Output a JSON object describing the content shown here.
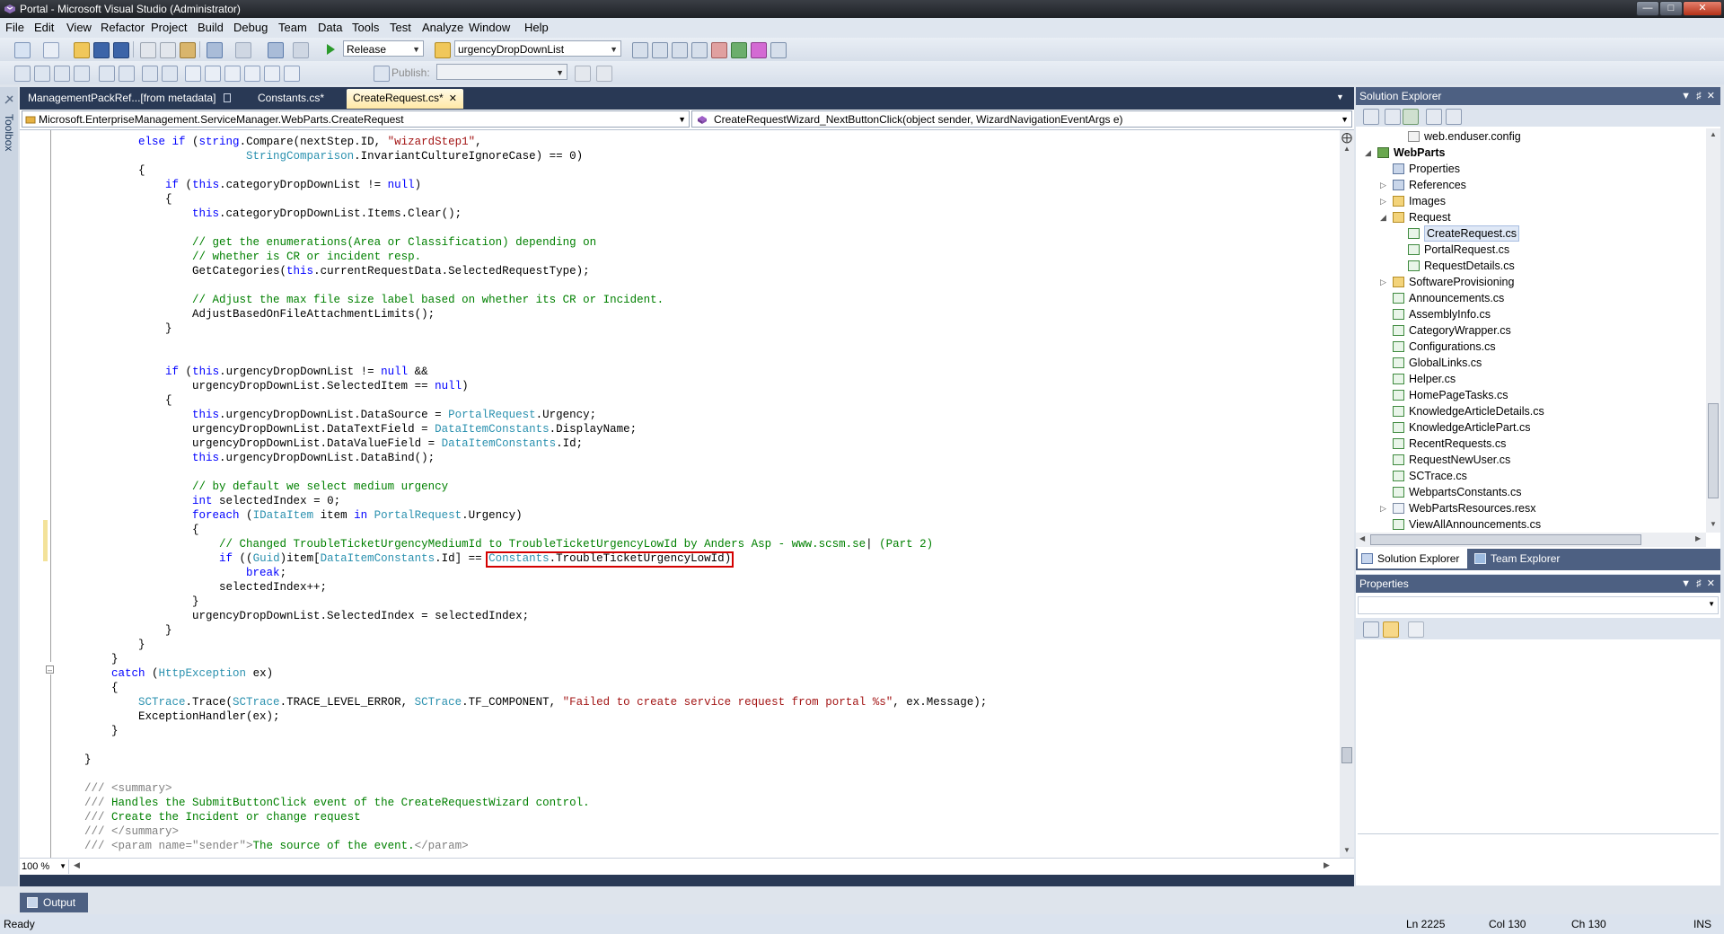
{
  "window": {
    "title": "Portal - Microsoft Visual Studio (Administrator)"
  },
  "menu": [
    "File",
    "Edit",
    "View",
    "Refactor",
    "Project",
    "Build",
    "Debug",
    "Team",
    "Data",
    "Tools",
    "Test",
    "Analyze",
    "Window",
    "Help"
  ],
  "toolbar": {
    "configuration": "Release",
    "find_combo": "urgencyDropDownList",
    "publish_label": "Publish:"
  },
  "toolbox": {
    "label": "Toolbox"
  },
  "editor": {
    "tabs": [
      {
        "label": "ManagementPackRef...[from metadata]"
      },
      {
        "label": "Constants.cs*"
      },
      {
        "label": "CreateRequest.cs*"
      }
    ],
    "type_combo": "Microsoft.EnterpriseManagement.ServiceManager.WebParts.CreateRequest",
    "member_combo": "CreateRequestWizard_NextButtonClick(object sender, WizardNavigationEventArgs e)",
    "zoom": "100 %",
    "code_lines": [
      {
        "t": [
          [
            "",
            "            "
          ],
          [
            "kw",
            "else if"
          ],
          [
            "",
            " ("
          ],
          [
            "kw",
            "string"
          ],
          [
            "",
            ".Compare(nextStep.ID, "
          ],
          [
            "st",
            "\"wizardStep1\""
          ],
          [
            "",
            ","
          ]
        ]
      },
      {
        "t": [
          [
            "",
            "                            "
          ],
          [
            "ty",
            "StringComparison"
          ],
          [
            "",
            ".InvariantCultureIgnoreCase) == 0)"
          ]
        ]
      },
      {
        "t": [
          [
            "",
            "            {"
          ]
        ]
      },
      {
        "t": [
          [
            "",
            "                "
          ],
          [
            "kw",
            "if"
          ],
          [
            "",
            " ("
          ],
          [
            "kw",
            "this"
          ],
          [
            "",
            ".categoryDropDownList != "
          ],
          [
            "kw",
            "null"
          ],
          [
            "",
            ")"
          ]
        ]
      },
      {
        "t": [
          [
            "",
            "                {"
          ]
        ]
      },
      {
        "t": [
          [
            "",
            "                    "
          ],
          [
            "kw",
            "this"
          ],
          [
            "",
            ".categoryDropDownList.Items.Clear();"
          ]
        ]
      },
      {
        "t": [
          [
            "",
            ""
          ]
        ]
      },
      {
        "t": [
          [
            "",
            "                    "
          ],
          [
            "cm",
            "// get the enumerations(Area or Classification) depending on"
          ]
        ]
      },
      {
        "t": [
          [
            "",
            "                    "
          ],
          [
            "cm",
            "// whether is CR or incident resp."
          ]
        ]
      },
      {
        "t": [
          [
            "",
            "                    GetCategories("
          ],
          [
            "kw",
            "this"
          ],
          [
            "",
            ".currentRequestData.SelectedRequestType);"
          ]
        ]
      },
      {
        "t": [
          [
            "",
            ""
          ]
        ]
      },
      {
        "t": [
          [
            "",
            "                    "
          ],
          [
            "cm",
            "// Adjust the max file size label based on whether its CR or Incident."
          ]
        ]
      },
      {
        "t": [
          [
            "",
            "                    AdjustBasedOnFileAttachmentLimits();"
          ]
        ]
      },
      {
        "t": [
          [
            "",
            "                }"
          ]
        ]
      },
      {
        "t": [
          [
            "",
            ""
          ]
        ]
      },
      {
        "t": [
          [
            "",
            ""
          ]
        ]
      },
      {
        "t": [
          [
            "",
            "                "
          ],
          [
            "kw",
            "if"
          ],
          [
            "",
            " ("
          ],
          [
            "kw",
            "this"
          ],
          [
            "",
            ".urgencyDropDownList != "
          ],
          [
            "kw",
            "null"
          ],
          [
            "",
            " &&"
          ]
        ]
      },
      {
        "t": [
          [
            "",
            "                    urgencyDropDownList.SelectedItem == "
          ],
          [
            "kw",
            "null"
          ],
          [
            "",
            ")"
          ]
        ]
      },
      {
        "t": [
          [
            "",
            "                {"
          ]
        ]
      },
      {
        "t": [
          [
            "",
            "                    "
          ],
          [
            "kw",
            "this"
          ],
          [
            "",
            ".urgencyDropDownList.DataSource = "
          ],
          [
            "ty",
            "PortalRequest"
          ],
          [
            "",
            ".Urgency;"
          ]
        ]
      },
      {
        "t": [
          [
            "",
            "                    urgencyDropDownList.DataTextField = "
          ],
          [
            "ty",
            "DataItemConstants"
          ],
          [
            "",
            ".DisplayName;"
          ]
        ]
      },
      {
        "t": [
          [
            "",
            "                    urgencyDropDownList.DataValueField = "
          ],
          [
            "ty",
            "DataItemConstants"
          ],
          [
            "",
            ".Id;"
          ]
        ]
      },
      {
        "t": [
          [
            "",
            "                    "
          ],
          [
            "kw",
            "this"
          ],
          [
            "",
            ".urgencyDropDownList.DataBind();"
          ]
        ]
      },
      {
        "t": [
          [
            "",
            ""
          ]
        ]
      },
      {
        "t": [
          [
            "",
            "                    "
          ],
          [
            "cm",
            "// by default we select medium urgency"
          ]
        ]
      },
      {
        "t": [
          [
            "",
            "                    "
          ],
          [
            "kw",
            "int"
          ],
          [
            "",
            " selectedIndex = 0;"
          ]
        ]
      },
      {
        "t": [
          [
            "",
            "                    "
          ],
          [
            "kw",
            "foreach"
          ],
          [
            "",
            " ("
          ],
          [
            "ty",
            "IDataItem"
          ],
          [
            "",
            " item "
          ],
          [
            "kw",
            "in"
          ],
          [
            "",
            " "
          ],
          [
            "ty",
            "PortalRequest"
          ],
          [
            "",
            ".Urgency)"
          ]
        ]
      },
      {
        "t": [
          [
            "",
            "                    {"
          ]
        ]
      },
      {
        "t": [
          [
            "",
            "                        "
          ],
          [
            "cm",
            "// Changed TroubleTicketUrgencyMediumId to TroubleTicketUrgencyLowId by Anders Asp - www.scsm.se"
          ],
          [
            "",
            "| "
          ],
          [
            "cm",
            "(Part 2)"
          ]
        ]
      },
      {
        "t": [
          [
            "",
            "                        "
          ],
          [
            "kw",
            "if"
          ],
          [
            "",
            " (("
          ],
          [
            "ty",
            "Guid"
          ],
          [
            "",
            ")item["
          ],
          [
            "ty",
            "DataItemConstants"
          ],
          [
            "",
            ".Id] == "
          ],
          [
            "ty",
            "Constants"
          ],
          [
            "",
            ".TroubleTicketUrgencyLowId)"
          ]
        ]
      },
      {
        "t": [
          [
            "",
            "                            "
          ],
          [
            "kw",
            "break"
          ],
          [
            "",
            ";"
          ]
        ]
      },
      {
        "t": [
          [
            "",
            "                        selectedIndex++;"
          ]
        ]
      },
      {
        "t": [
          [
            "",
            "                    }"
          ]
        ]
      },
      {
        "t": [
          [
            "",
            "                    urgencyDropDownList.SelectedIndex = selectedIndex;"
          ]
        ]
      },
      {
        "t": [
          [
            "",
            "                }"
          ]
        ]
      },
      {
        "t": [
          [
            "",
            "            }"
          ]
        ]
      },
      {
        "t": [
          [
            "",
            "        }"
          ]
        ]
      },
      {
        "t": [
          [
            "",
            "        "
          ],
          [
            "kw",
            "catch"
          ],
          [
            "",
            " ("
          ],
          [
            "ty",
            "HttpException"
          ],
          [
            "",
            " ex)"
          ]
        ]
      },
      {
        "t": [
          [
            "",
            "        {"
          ]
        ]
      },
      {
        "t": [
          [
            "",
            "            "
          ],
          [
            "ty",
            "SCTrace"
          ],
          [
            "",
            ".Trace("
          ],
          [
            "ty",
            "SCTrace"
          ],
          [
            "",
            ".TRACE_LEVEL_ERROR, "
          ],
          [
            "ty",
            "SCTrace"
          ],
          [
            "",
            ".TF_COMPONENT, "
          ],
          [
            "st",
            "\"Failed to create service request from portal %s\""
          ],
          [
            "",
            ", ex.Message);"
          ]
        ]
      },
      {
        "t": [
          [
            "",
            "            ExceptionHandler(ex);"
          ]
        ]
      },
      {
        "t": [
          [
            "",
            "        }"
          ]
        ]
      },
      {
        "t": [
          [
            "",
            ""
          ]
        ]
      },
      {
        "t": [
          [
            "",
            "    }"
          ]
        ]
      },
      {
        "t": [
          [
            "",
            ""
          ]
        ]
      },
      {
        "t": [
          [
            "",
            "    "
          ],
          [
            "dc",
            "/// <summary>"
          ]
        ]
      },
      {
        "t": [
          [
            "",
            "    "
          ],
          [
            "dc",
            "///"
          ],
          [
            "cm",
            " Handles the SubmitButtonClick event of the CreateRequestWizard control."
          ]
        ]
      },
      {
        "t": [
          [
            "",
            "    "
          ],
          [
            "dc",
            "///"
          ],
          [
            "cm",
            " Create the Incident or change request"
          ]
        ]
      },
      {
        "t": [
          [
            "",
            "    "
          ],
          [
            "dc",
            "/// </summary>"
          ]
        ]
      },
      {
        "t": [
          [
            "",
            "    "
          ],
          [
            "dc",
            "/// <param name=\"sender\">"
          ],
          [
            "cm",
            "The source of the event."
          ],
          [
            "dc",
            "</param>"
          ]
        ]
      }
    ]
  },
  "solution_explorer": {
    "title": "Solution Explorer",
    "items": [
      {
        "label": "web.enduser.config",
        "level": 2,
        "icon": "config-file-icon",
        "exp": ""
      },
      {
        "label": "WebParts",
        "level": 0,
        "icon": "project-icon",
        "exp": "open",
        "bold": true
      },
      {
        "label": "Properties",
        "level": 1,
        "icon": "properties-icon",
        "exp": ""
      },
      {
        "label": "References",
        "level": 1,
        "icon": "references-icon",
        "exp": "closed"
      },
      {
        "label": "Images",
        "level": 1,
        "icon": "folder-icon",
        "exp": "closed"
      },
      {
        "label": "Request",
        "level": 1,
        "icon": "folder-open-icon",
        "exp": "open"
      },
      {
        "label": "CreateRequest.cs",
        "level": 2,
        "icon": "cs-file-icon",
        "exp": "",
        "selected": true
      },
      {
        "label": "PortalRequest.cs",
        "level": 2,
        "icon": "cs-file-icon",
        "exp": ""
      },
      {
        "label": "RequestDetails.cs",
        "level": 2,
        "icon": "cs-file-icon",
        "exp": ""
      },
      {
        "label": "SoftwareProvisioning",
        "level": 1,
        "icon": "folder-icon",
        "exp": "closed"
      },
      {
        "label": "Announcements.cs",
        "level": 1,
        "icon": "cs-file-icon",
        "exp": ""
      },
      {
        "label": "AssemblyInfo.cs",
        "level": 1,
        "icon": "cs-file-icon",
        "exp": ""
      },
      {
        "label": "CategoryWrapper.cs",
        "level": 1,
        "icon": "cs-file-icon",
        "exp": ""
      },
      {
        "label": "Configurations.cs",
        "level": 1,
        "icon": "cs-file-icon",
        "exp": ""
      },
      {
        "label": "GlobalLinks.cs",
        "level": 1,
        "icon": "cs-file-icon",
        "exp": ""
      },
      {
        "label": "Helper.cs",
        "level": 1,
        "icon": "cs-file-icon",
        "exp": ""
      },
      {
        "label": "HomePageTasks.cs",
        "level": 1,
        "icon": "cs-file-icon",
        "exp": ""
      },
      {
        "label": "KnowledgeArticleDetails.cs",
        "level": 1,
        "icon": "cs-file-icon",
        "exp": ""
      },
      {
        "label": "KnowledgeArticlePart.cs",
        "level": 1,
        "icon": "cs-file-icon",
        "exp": ""
      },
      {
        "label": "RecentRequests.cs",
        "level": 1,
        "icon": "cs-file-icon",
        "exp": ""
      },
      {
        "label": "RequestNewUser.cs",
        "level": 1,
        "icon": "cs-file-icon",
        "exp": ""
      },
      {
        "label": "SCTrace.cs",
        "level": 1,
        "icon": "cs-file-icon",
        "exp": ""
      },
      {
        "label": "WebpartsConstants.cs",
        "level": 1,
        "icon": "cs-file-icon",
        "exp": ""
      },
      {
        "label": "WebPartsResources.resx",
        "level": 1,
        "icon": "resx-file-icon",
        "exp": "closed"
      },
      {
        "label": "ViewAllAnnouncements.cs",
        "level": 1,
        "icon": "cs-file-icon",
        "exp": ""
      }
    ],
    "tabs": [
      {
        "label": "Solution Explorer"
      },
      {
        "label": "Team Explorer"
      }
    ]
  },
  "properties": {
    "title": "Properties"
  },
  "output": {
    "label": "Output"
  },
  "status": {
    "ready": "Ready",
    "line": "Ln 2225",
    "col": "Col 130",
    "ch": "Ch 130",
    "mode": "INS"
  },
  "colors": {
    "keyword": "#0000ff",
    "type": "#2b91af",
    "string": "#a31515",
    "comment": "#008000",
    "highlight_box": "#d40000"
  }
}
